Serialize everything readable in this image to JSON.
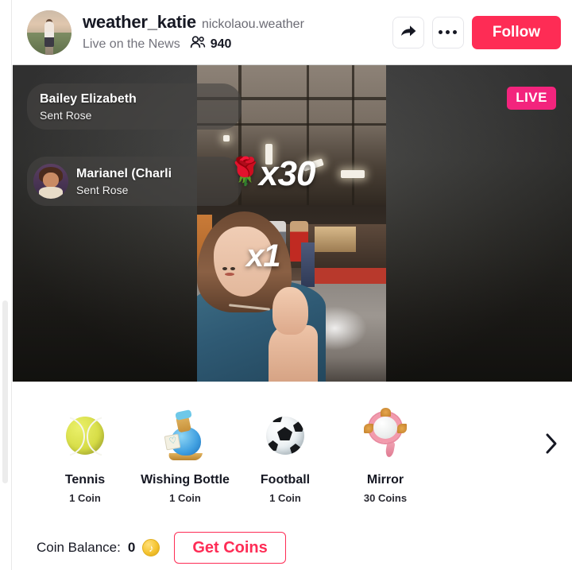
{
  "header": {
    "avatar_name": "creator-avatar",
    "username": "weather_katie",
    "handle": "nickolaou.weather",
    "live_topic": "Live on the News",
    "viewers_icon": "viewers-icon",
    "viewers_count": "940",
    "share_icon": "share-icon",
    "more_icon": "more-options-icon",
    "follow_label": "Follow"
  },
  "stage": {
    "live_badge": "LIVE",
    "multiplier_top": "x30",
    "multiplier_bottom": "x1",
    "gift_emoji": "🌹",
    "chat": [
      {
        "name": "Bailey Elizabeth",
        "message": "Sent Rose",
        "has_avatar": false,
        "has_gift": false
      },
      {
        "name": "Marianel (Charli",
        "message": "Sent Rose",
        "has_avatar": true,
        "has_gift": true
      }
    ]
  },
  "gifts": {
    "next_icon": "chevron-right-icon",
    "items": [
      {
        "name": "Tennis",
        "price": "1 Coin",
        "icon": "tennis-ball-icon"
      },
      {
        "name": "Wishing Bottle",
        "price": "1 Coin",
        "icon": "wishing-bottle-icon"
      },
      {
        "name": "Football",
        "price": "1 Coin",
        "icon": "soccer-ball-icon"
      },
      {
        "name": "Mirror",
        "price": "30 Coins",
        "icon": "hand-mirror-icon"
      }
    ]
  },
  "bottom": {
    "balance_label": "Coin Balance:",
    "balance_value": "0",
    "coin_icon": "tiktok-coin-icon",
    "coin_glyph": "♪",
    "get_coins_label": "Get Coins"
  },
  "colors": {
    "brand_red": "#fe2c55",
    "live_pink": "#f3247d",
    "text_primary": "#161823",
    "text_secondary": "#73737c"
  }
}
